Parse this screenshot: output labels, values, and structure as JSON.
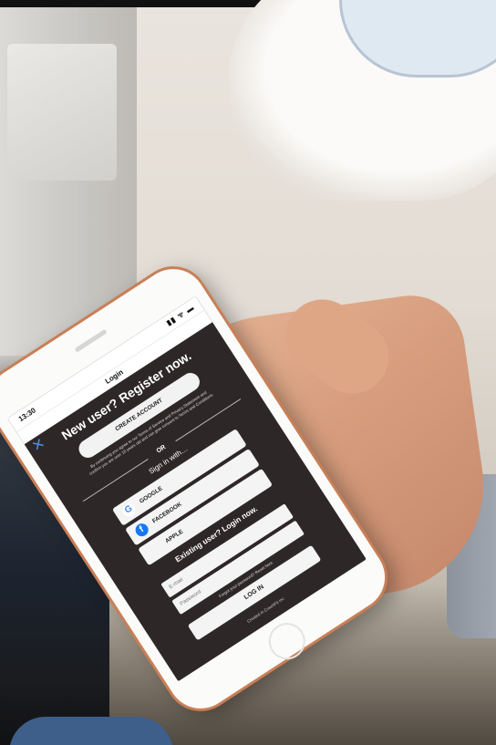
{
  "status_bar": {
    "time": "13:30",
    "icons": "▮▮ ᯤ ▬"
  },
  "nav": {
    "title": "Login",
    "close_symbol": "✕"
  },
  "register": {
    "headline": "New user? Register now.",
    "create_label": "CREATE ACCOUNT",
    "terms": "By continuing you agree to our Terms of Service and Privacy Statement and confirm you are over 16 years old and can give consent to Terms and Conditions."
  },
  "divider": {
    "or_label": "OR"
  },
  "social": {
    "heading": "Sign in with…",
    "items": [
      {
        "label": "GOOGLE",
        "icon": "google-icon",
        "glyph": "G"
      },
      {
        "label": "FACEBOOK",
        "icon": "facebook-icon",
        "glyph": "f"
      },
      {
        "label": "APPLE",
        "icon": "apple-icon",
        "glyph": ""
      }
    ]
  },
  "login": {
    "heading": "Existing user? Login now.",
    "email_placeholder": "E-mail",
    "password_placeholder": "Password",
    "forgot": "Forgot your password? Reset here",
    "button_label": "LOG IN"
  },
  "footer": {
    "text": "Created in CoachFit Inc"
  },
  "colors": {
    "screen_bg": "#2e2728",
    "accent_blue": "#4a8fe0",
    "phone_frame": "#c97f55",
    "facebook_blue": "#1877f2"
  }
}
